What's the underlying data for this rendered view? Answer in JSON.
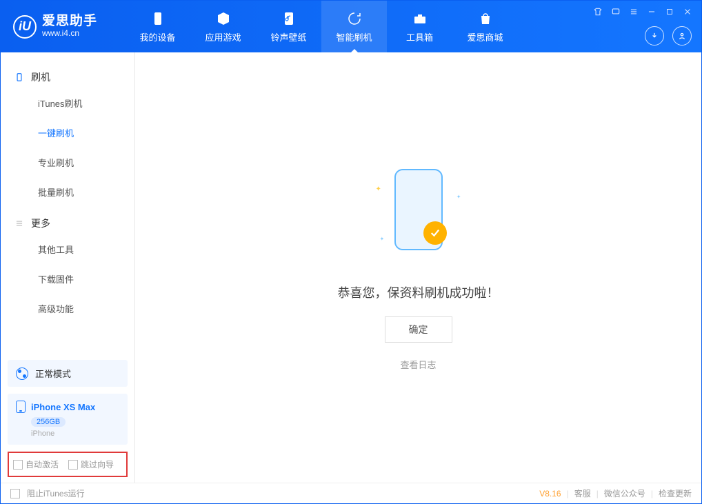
{
  "app": {
    "title": "爱思助手",
    "subtitle": "www.i4.cn"
  },
  "nav": {
    "device": "我的设备",
    "apps": "应用游戏",
    "ringtones": "铃声壁纸",
    "flash": "智能刷机",
    "toolbox": "工具箱",
    "store": "爱思商城"
  },
  "sidebar": {
    "section_flash": "刷机",
    "itunes_flash": "iTunes刷机",
    "one_click_flash": "一键刷机",
    "pro_flash": "专业刷机",
    "batch_flash": "批量刷机",
    "section_more": "更多",
    "other_tools": "其他工具",
    "download_firmware": "下载固件",
    "advanced": "高级功能"
  },
  "mode": {
    "label": "正常模式"
  },
  "device": {
    "name": "iPhone XS Max",
    "capacity": "256GB",
    "type": "iPhone"
  },
  "options": {
    "auto_activate": "自动激活",
    "skip_guide": "跳过向导"
  },
  "main": {
    "success_message": "恭喜您，保资料刷机成功啦！",
    "ok": "确定",
    "view_log": "查看日志"
  },
  "footer": {
    "block_itunes": "阻止iTunes运行",
    "version": "V8.16",
    "support": "客服",
    "wechat": "微信公众号",
    "check_update": "检查更新"
  }
}
